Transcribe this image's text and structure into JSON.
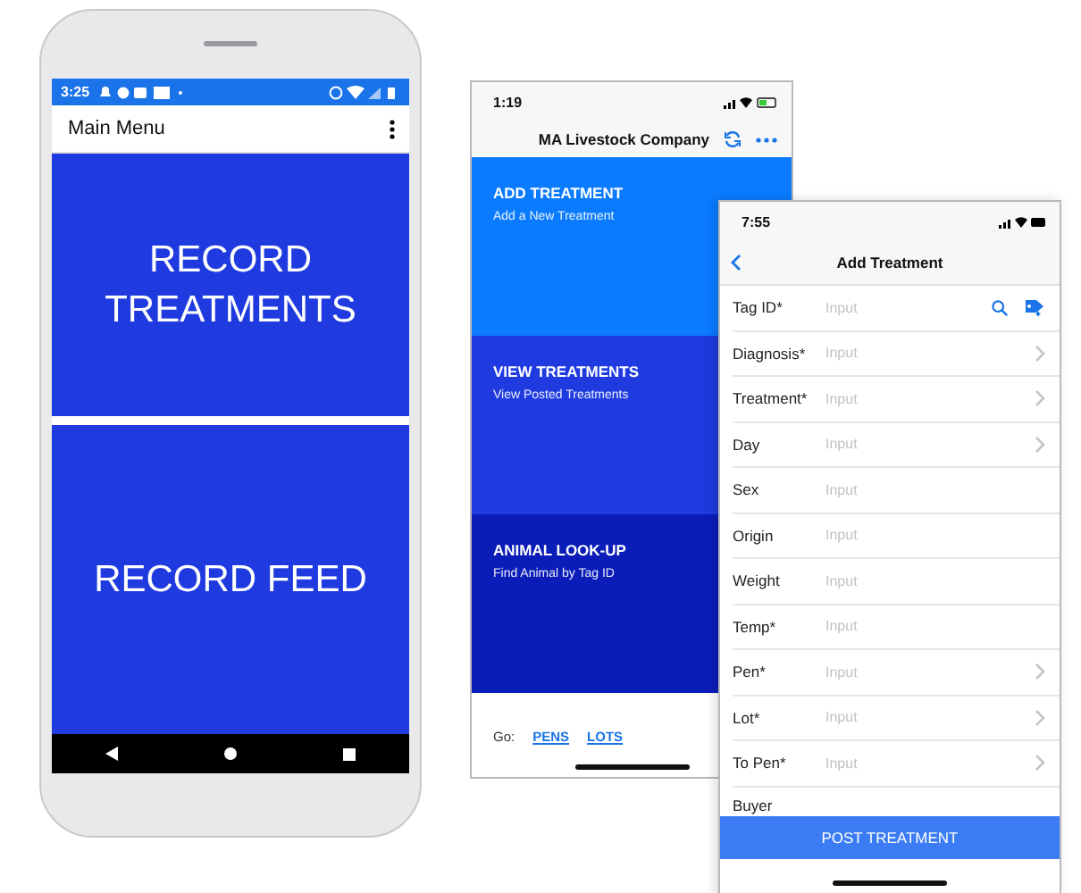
{
  "android": {
    "status_time": "3:25",
    "app_title": "Main Menu",
    "tiles": [
      {
        "label": "RECORD TREATMENTS"
      },
      {
        "label": "RECORD FEED"
      }
    ]
  },
  "menu_screen": {
    "status_time": "1:19",
    "company": "MA Livestock Company",
    "tiles": [
      {
        "title": "ADD TREATMENT",
        "subtitle": "Add a New Treatment",
        "color": "#0a7bff"
      },
      {
        "title": "VIEW TREATMENTS",
        "subtitle": "View Posted Treatments",
        "color": "#1f3be0"
      },
      {
        "title": "ANIMAL LOOK-UP",
        "subtitle": "Find Animal by Tag ID",
        "color": "#0a1db8"
      }
    ],
    "go_label": "Go:",
    "links": [
      "PENS",
      "LOTS"
    ]
  },
  "form_screen": {
    "status_time": "7:55",
    "title": "Add Treatment",
    "fields": [
      {
        "label": "Tag ID*",
        "placeholder": "Input",
        "kind": "lookup"
      },
      {
        "label": "Diagnosis*",
        "placeholder": "Input",
        "kind": "picker"
      },
      {
        "label": "Treatment*",
        "placeholder": "Input",
        "kind": "picker"
      },
      {
        "label": "Day",
        "placeholder": "Input",
        "kind": "picker"
      },
      {
        "label": "Sex",
        "placeholder": "Input",
        "kind": "text"
      },
      {
        "label": "Origin",
        "placeholder": "Input",
        "kind": "text"
      },
      {
        "label": "Weight",
        "placeholder": "Input",
        "kind": "text"
      },
      {
        "label": "Temp*",
        "placeholder": "Input",
        "kind": "text"
      },
      {
        "label": "Pen*",
        "placeholder": "Input",
        "kind": "picker"
      },
      {
        "label": "Lot*",
        "placeholder": "Input",
        "kind": "picker"
      },
      {
        "label": "To Pen*",
        "placeholder": "Input",
        "kind": "picker"
      },
      {
        "label": "Buyer",
        "kind": "text"
      }
    ],
    "submit": "POST TREATMENT"
  }
}
